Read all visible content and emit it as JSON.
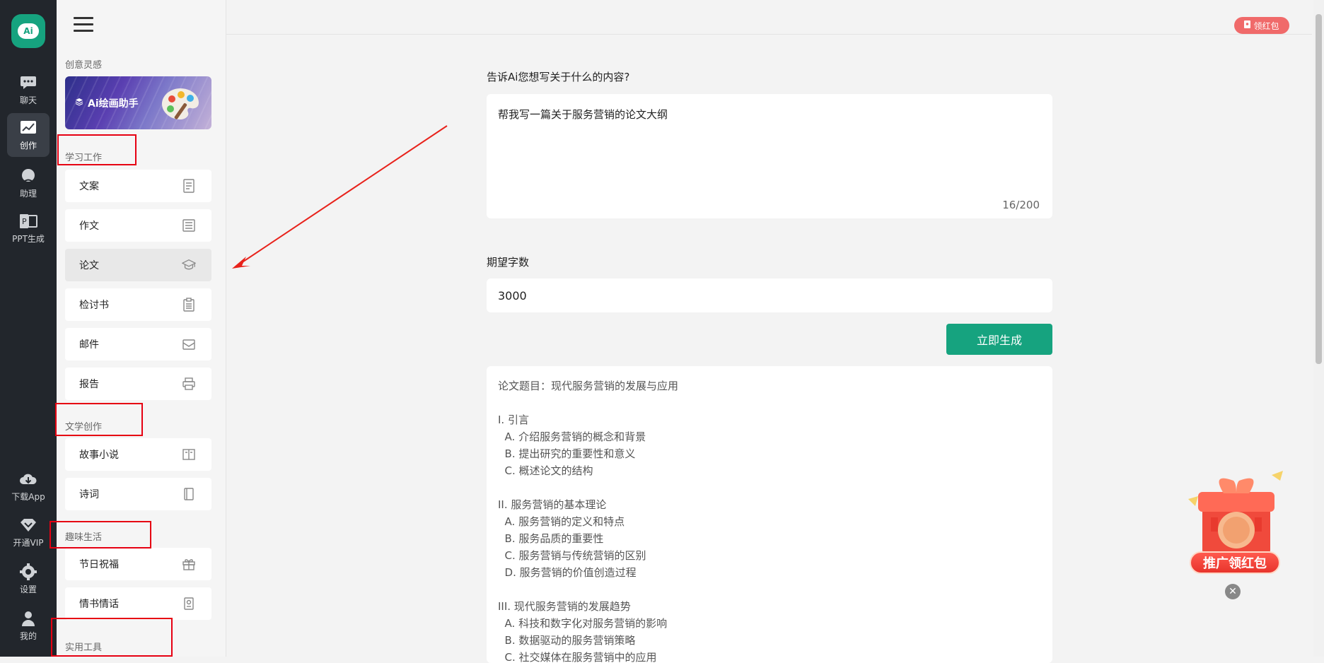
{
  "rail": {
    "logo_text": "Ai",
    "items": [
      {
        "label": "聊天",
        "icon": "chat-bubble-icon"
      },
      {
        "label": "创作",
        "icon": "chart-line-icon"
      },
      {
        "label": "助理",
        "icon": "assistant-icon"
      },
      {
        "label": "PPT生成",
        "icon": "ppt-icon"
      }
    ],
    "bottom_items": [
      {
        "label": "下载App",
        "icon": "cloud-download-icon"
      },
      {
        "label": "开通VIP",
        "icon": "diamond-icon"
      },
      {
        "label": "设置",
        "icon": "gear-icon"
      },
      {
        "label": "我的",
        "icon": "user-icon"
      }
    ]
  },
  "sidebar": {
    "inspiration_title": "创意灵感",
    "banner_label": "Ai绘画助手",
    "sections": [
      {
        "title": "学习工作",
        "items": [
          {
            "label": "文案",
            "icon": "document-icon"
          },
          {
            "label": "作文",
            "icon": "newspaper-icon"
          },
          {
            "label": "论文",
            "icon": "graduation-cap-icon"
          },
          {
            "label": "检讨书",
            "icon": "clipboard-icon"
          },
          {
            "label": "邮件",
            "icon": "mail-icon"
          },
          {
            "label": "报告",
            "icon": "printer-icon"
          }
        ]
      },
      {
        "title": "文学创作",
        "items": [
          {
            "label": "故事小说",
            "icon": "open-book-icon"
          },
          {
            "label": "诗词",
            "icon": "book-icon"
          }
        ]
      },
      {
        "title": "趣味生活",
        "items": [
          {
            "label": "节日祝福",
            "icon": "gift-icon"
          },
          {
            "label": "情书情话",
            "icon": "letter-icon"
          }
        ]
      },
      {
        "title": "实用工具",
        "items": []
      }
    ]
  },
  "topbar": {
    "redpacket_label": "领红包"
  },
  "form": {
    "prompt_label": "告诉Ai您想写关于什么的内容?",
    "prompt_value": "帮我写一篇关于服务营销的论文大纲",
    "prompt_counter": "16/200",
    "words_label": "期望字数",
    "words_value": "3000",
    "generate_label": "立即生成"
  },
  "result": {
    "lines": [
      "论文题目：现代服务营销的发展与应用",
      "",
      "I. 引言",
      "  A. 介绍服务营销的概念和背景",
      "  B. 提出研究的重要性和意义",
      "  C. 概述论文的结构",
      "",
      "II. 服务营销的基本理论",
      "  A. 服务营销的定义和特点",
      "  B. 服务品质的重要性",
      "  C. 服务营销与传统营销的区别",
      "  D. 服务营销的价值创造过程",
      "",
      "III. 现代服务营销的发展趋势",
      "  A. 科技和数字化对服务营销的影响",
      "  B. 数据驱动的服务营销策略",
      "  C. 社交媒体在服务营销中的应用"
    ]
  },
  "promo": {
    "label": "推广领红包",
    "close": "✕"
  },
  "colors": {
    "accent": "#16a37f",
    "rail_bg": "#22262c",
    "annotation_red": "#e60012",
    "arrow_red": "#e8221b"
  }
}
